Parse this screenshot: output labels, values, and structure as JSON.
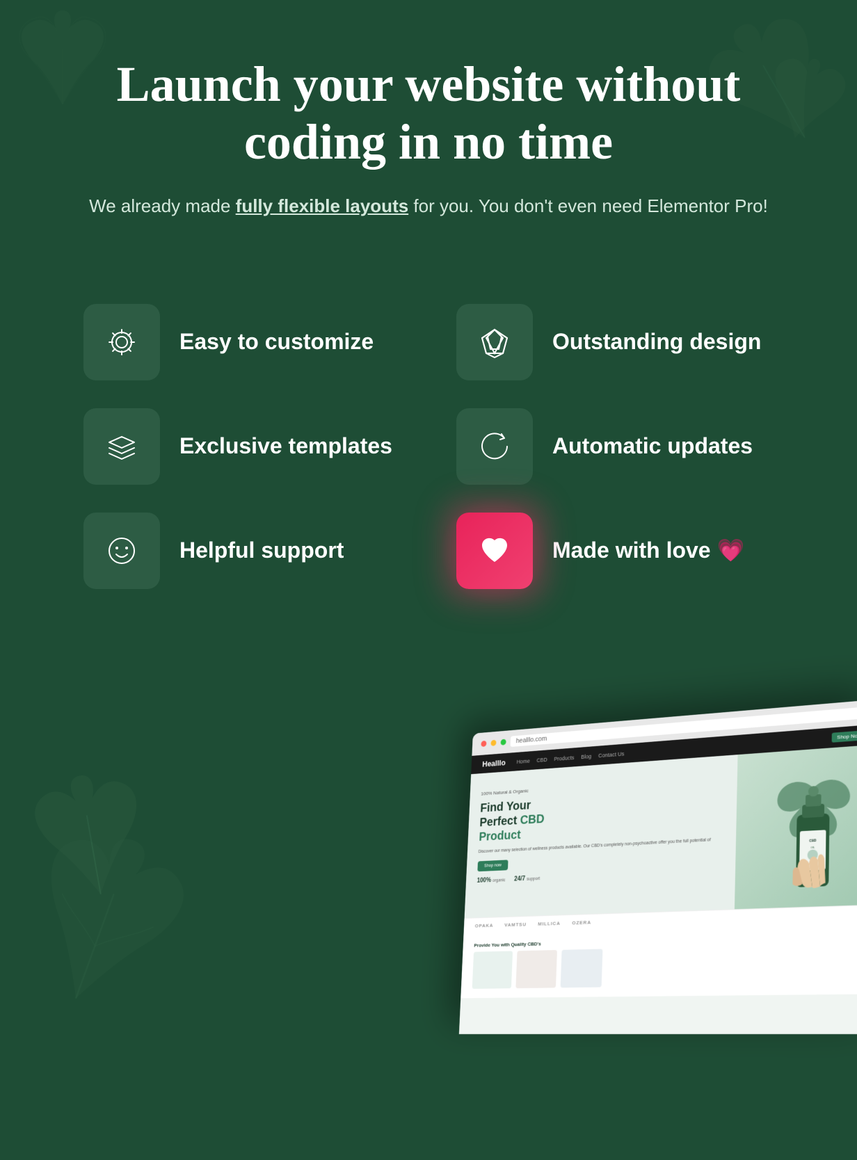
{
  "page": {
    "background_color": "#1e4d35"
  },
  "hero": {
    "title": "Launch your website without coding in no time",
    "subtitle_prefix": "We already made ",
    "subtitle_highlight": "fully flexible layouts",
    "subtitle_suffix": " for you. You don't even need Elementor Pro!"
  },
  "features": [
    {
      "id": "easy-customize",
      "icon": "gear-icon",
      "label": "Easy to customize",
      "icon_style": "dark-green"
    },
    {
      "id": "outstanding-design",
      "icon": "diamond-icon",
      "label": "Outstanding design",
      "icon_style": "dark-green"
    },
    {
      "id": "exclusive-templates",
      "icon": "layers-icon",
      "label": "Exclusive templates",
      "icon_style": "dark-green"
    },
    {
      "id": "automatic-updates",
      "icon": "refresh-icon",
      "label": "Automatic updates",
      "icon_style": "dark-green"
    },
    {
      "id": "helpful-support",
      "icon": "smiley-icon",
      "label": "Helpful support",
      "icon_style": "dark-green"
    },
    {
      "id": "made-with-love",
      "icon": "heart-icon",
      "label": "Made with love 💗",
      "icon_style": "pink"
    }
  ],
  "preview": {
    "logo": "Healllo",
    "nav_links": [
      "Home",
      "CBD",
      "Products",
      "Blog",
      "Contact Us"
    ],
    "hero_title": "Find Your Perfect CBD",
    "hero_title_green": "Product",
    "hero_desc": "Discover our many selection of wellness products available. Our CBD's completely non-psychoactive offer you the full potential of",
    "hero_btn": "Shop now",
    "stats": [
      {
        "value": "100%",
        "label": "organic"
      },
      {
        "value": "24/7",
        "label": "support"
      }
    ],
    "brands": [
      "OPAKA",
      "VAMTSU",
      "MILLICA",
      "OZERA"
    ]
  }
}
